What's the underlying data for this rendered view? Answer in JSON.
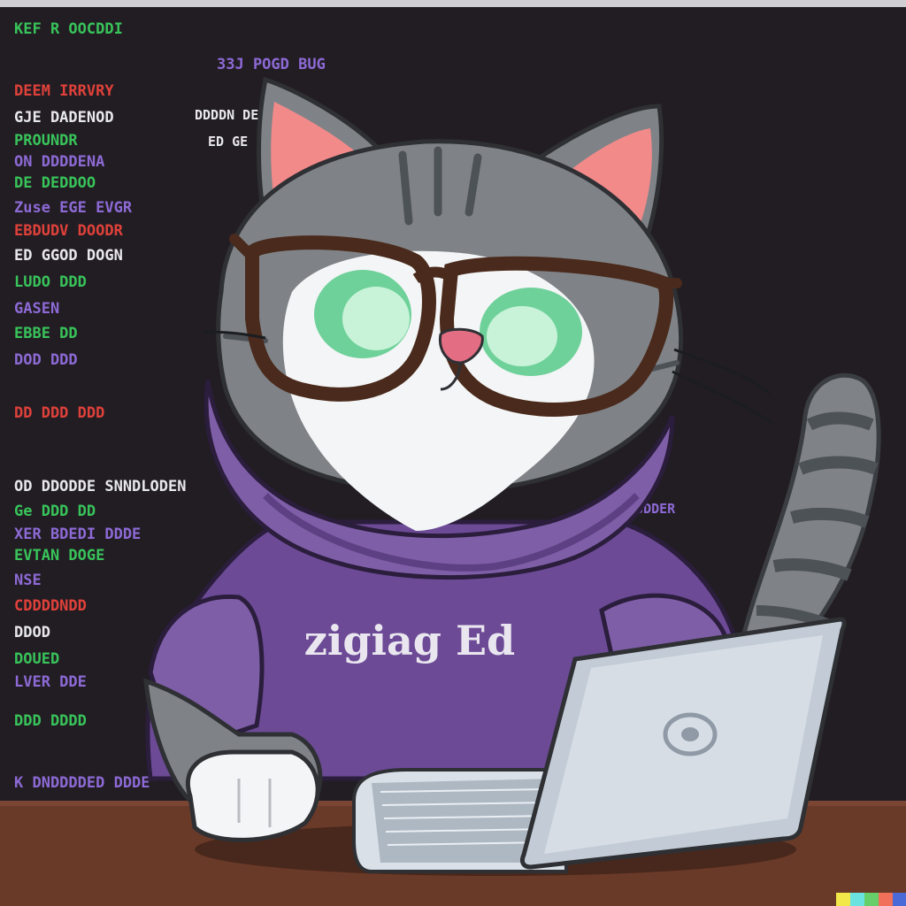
{
  "scene": {
    "hoodie_text": "zigiag Ed",
    "colors": {
      "backdrop": "#221d23",
      "frame_top": "#cfcfd2",
      "desk": "#6a3a28",
      "desk_shadow": "#3e2118",
      "cat_fur": "#7f8387",
      "cat_fur_light": "#9a9ea2",
      "cat_stripe": "#4d5257",
      "cat_white": "#f3f5f6",
      "ear_inner": "#f38a8a",
      "hoodie": "#6c4a96",
      "hoodie_dark": "#4f3373",
      "hoodie_light": "#7f5ea8",
      "glasses": "#4a2a1c",
      "lens_glow": "#6fd19a",
      "nose": "#e36d82",
      "laptop_body": "#c3ccd6",
      "laptop_edge": "#8f9aa6",
      "code_green": "#38c45a",
      "code_purple": "#8d6ad6",
      "code_red": "#e0413a",
      "code_white": "#e8e8ea"
    },
    "code_lines": [
      "KEF R  OOCDDI",
      "33J POGD  BUG",
      "DEEM IRRVRY",
      "GJE DADENOD",
      "PROUNDR",
      "ON DDDDENA",
      "DE  DEDDOO",
      "Zuse  EGE  EVGR",
      "EBDUDV DOODR",
      "ED GGOD  DOGN",
      "LUDO  DDD",
      "GASEN",
      "EBBE DD",
      "DOD  DDD",
      "DD DDD  DDD",
      "OD DDODDE SNNDLODEN",
      "Ge DDD  DD",
      "XER  BDEDI DDDE",
      "EVTAN DOGE",
      "NSE",
      "CDDDDNDD",
      "DDOD",
      "DOUED",
      "LVER DDE",
      "DDD  DDDD",
      "K DNDDDDED DDDE"
    ],
    "code_lines_right": [
      "DDDDN  DE",
      "ED GE",
      "SDUDDER"
    ],
    "watermark_colors": [
      "#f2e84a",
      "#6ae3e0",
      "#67cf6a",
      "#f0705a",
      "#4a6ad8"
    ]
  }
}
